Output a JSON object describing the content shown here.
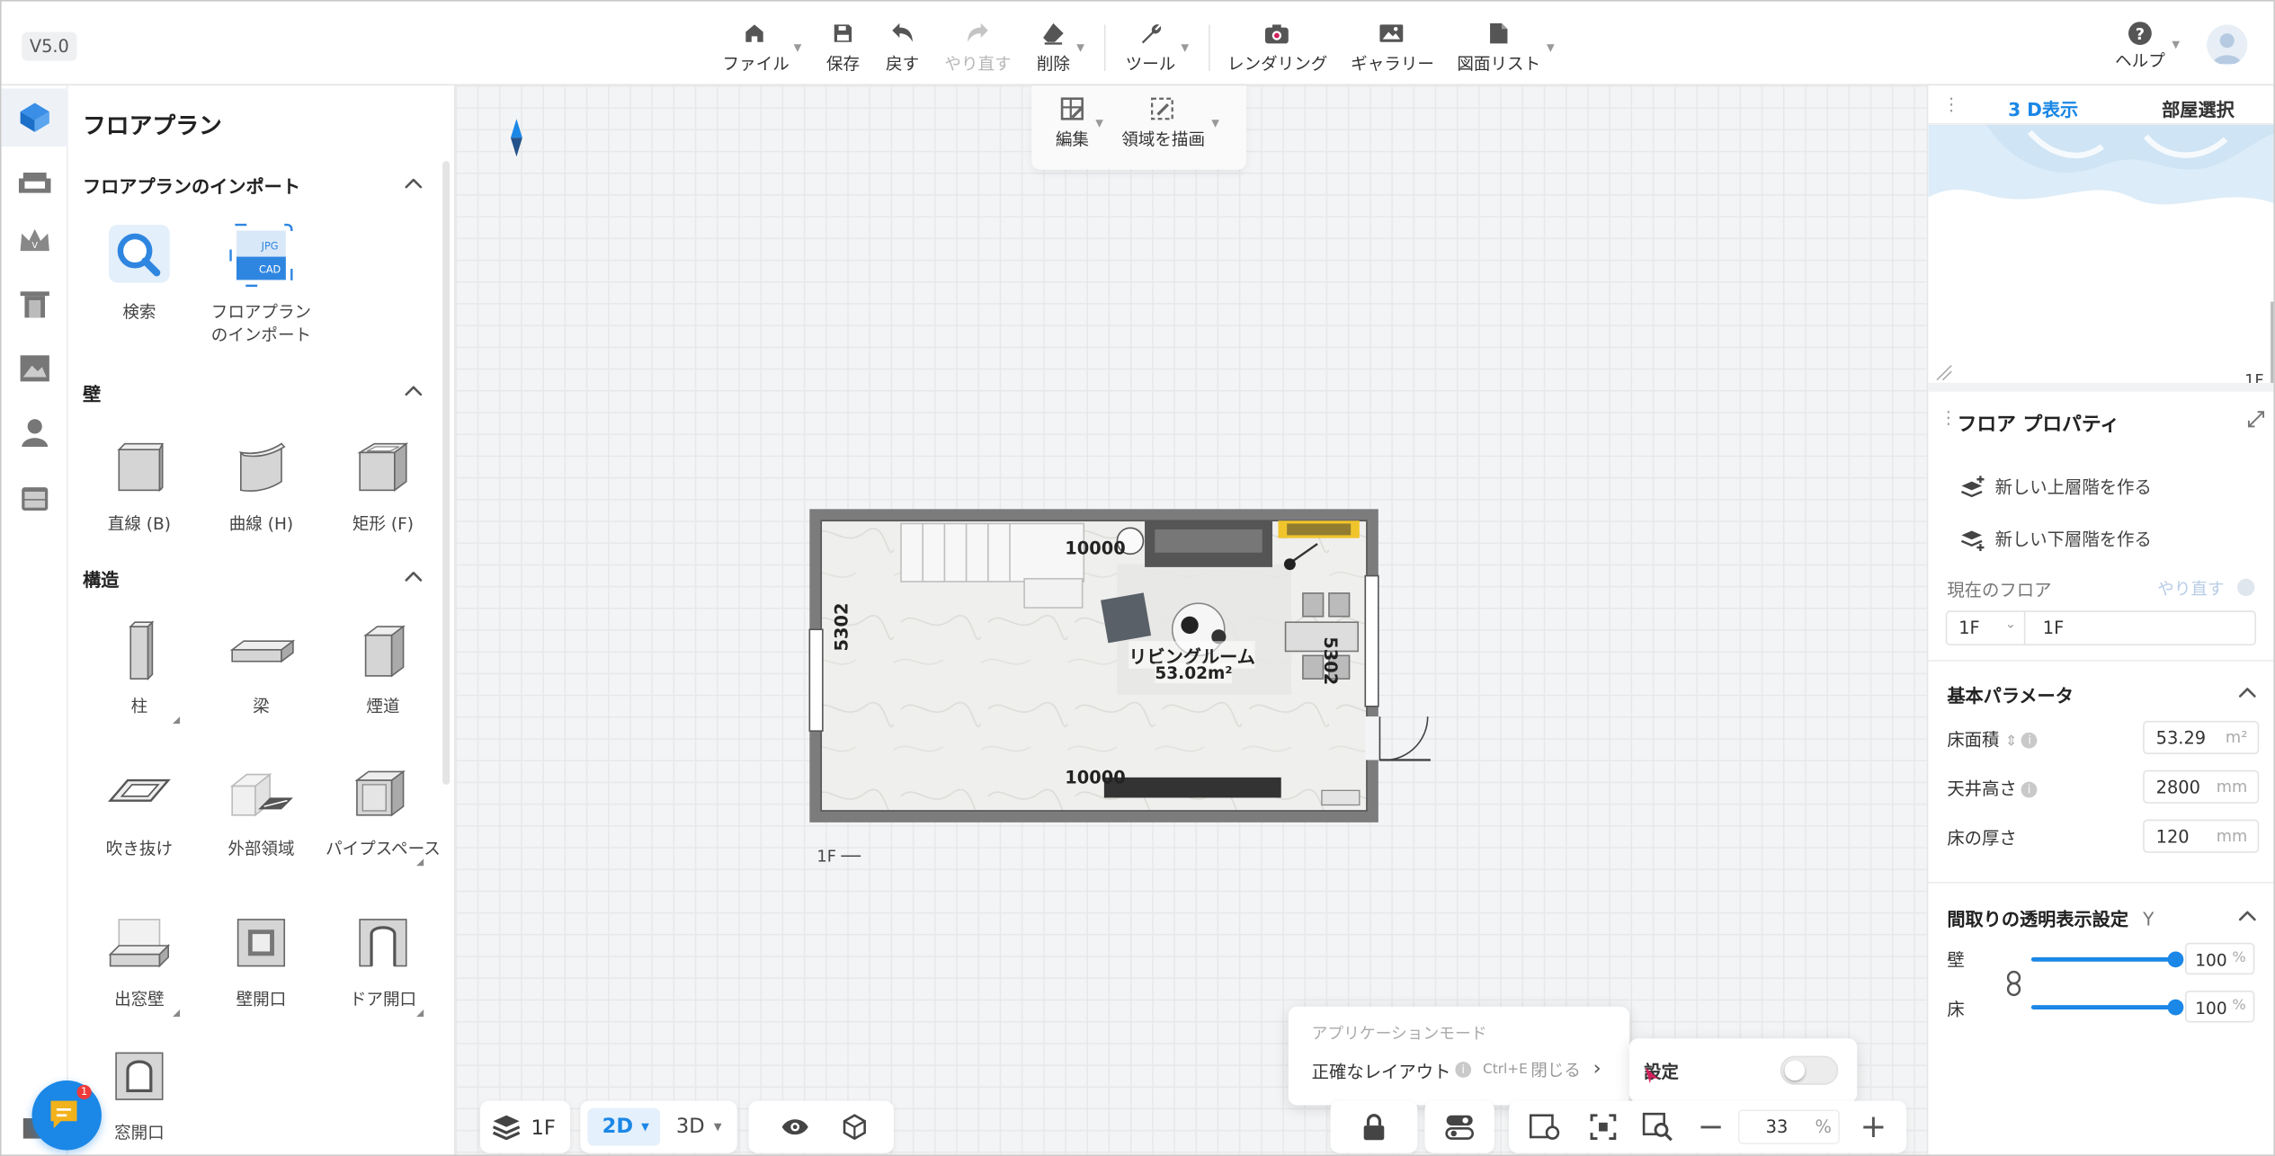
{
  "version": "V5.0",
  "toolbar": {
    "file": "ファイル",
    "save": "保存",
    "undo": "戻す",
    "redo": "やり直す",
    "delete": "削除",
    "tools": "ツール",
    "render": "レンダリング",
    "gallery": "ギャラリー",
    "drawing_list": "図面リスト",
    "help": "ヘルプ"
  },
  "edit_toolbar": {
    "edit": "編集",
    "draw_area": "領域を描画"
  },
  "catalog": {
    "title": "フロアプラン",
    "import_section": {
      "title": "フロアプランのインポート",
      "items": [
        {
          "label": "検索"
        },
        {
          "label": "フロアプラン\nのインポート"
        }
      ],
      "thumb_text": [
        "JPG",
        "CAD"
      ]
    },
    "wall_section": {
      "title": "壁",
      "items": [
        {
          "label": "直線 (B)"
        },
        {
          "label": "曲線 (H)"
        },
        {
          "label": "矩形 (F)"
        }
      ]
    },
    "structure_section": {
      "title": "構造",
      "items": [
        {
          "label": "柱"
        },
        {
          "label": "梁"
        },
        {
          "label": "煙道"
        },
        {
          "label": "吹き抜け"
        },
        {
          "label": "外部領域"
        },
        {
          "label": "パイプスペース"
        },
        {
          "label": "出窓壁"
        },
        {
          "label": "壁開口"
        },
        {
          "label": "ドア開口"
        },
        {
          "label": "窓開口"
        }
      ]
    }
  },
  "plan": {
    "dim_top": "10000",
    "dim_bottom": "10000",
    "dim_left": "5302",
    "dim_right": "5302",
    "room_name": "リビングルーム",
    "room_area": "53.02m²",
    "floor_tag": "1F ──"
  },
  "mode_popup": {
    "title": "アプリケーションモード",
    "mode": "正確なレイアウト",
    "info": "i",
    "shortcut": "Ctrl+E",
    "close": "閉じる",
    "settings": "設定",
    "settings_on": false
  },
  "bottom_bar": {
    "floor": "1F",
    "view_2d": "2D",
    "view_3d": "3D",
    "zoom": "33",
    "zoom_unit": "%"
  },
  "chat_badge": "1",
  "right_panel": {
    "tab_3d": "3 D表示",
    "tab_room": "部屋選択",
    "preview_floor": "1F",
    "floor_props_title": "フロア プロパティ",
    "new_upper": "新しい上層階を作る",
    "new_lower": "新しい下層階を作る",
    "current_floor_label": "現在のフロア",
    "redo_label": "やり直す",
    "floor_select": "1F",
    "floor_name": "1F",
    "basic_params_title": "基本パラメータ",
    "params": [
      {
        "label": "床面積",
        "value": "53.29",
        "unit": "m²"
      },
      {
        "label": "天井高さ",
        "value": "2800",
        "unit": "mm"
      },
      {
        "label": "床の厚さ",
        "value": "120",
        "unit": "mm"
      }
    ],
    "transparency_title": "間取りの透明表示設定",
    "transparency_key": "Y",
    "wall_label": "壁",
    "wall_value": "100",
    "floor_label": "床",
    "floor_value": "100",
    "pct": "%"
  },
  "colors": {
    "accent": "#1b87e6",
    "badge": "#ee3b3b",
    "cursor": "#d0215c"
  }
}
